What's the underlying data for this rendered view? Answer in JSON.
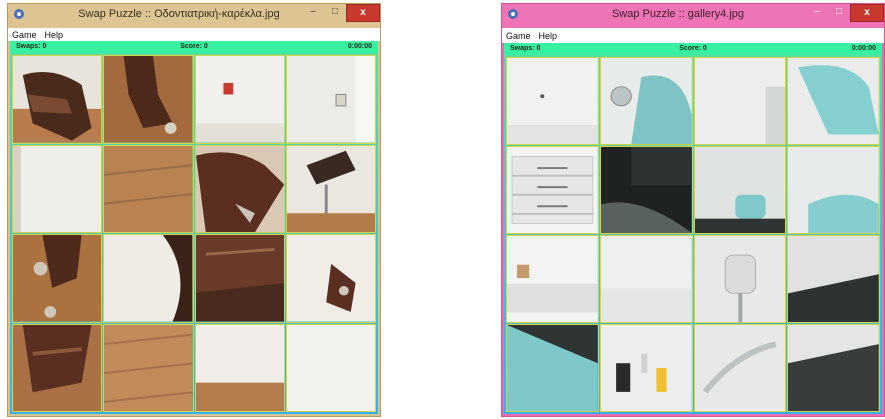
{
  "window1": {
    "title": "Swap Puzzle :: Οδοντιατρική-καρέκλα.jpg",
    "menu": [
      "Game",
      "Help"
    ],
    "status": {
      "swaps": "Swaps: 0",
      "score": "Score: 0",
      "time": "0:00:00"
    },
    "controls": {
      "minimize": "–",
      "maximize": "□",
      "close": "x"
    }
  },
  "window2": {
    "title": "Swap Puzzle :: gallery4.jpg",
    "menu": [
      "Game",
      "Help"
    ],
    "status": {
      "swaps": "Swaps: 0",
      "score": "Score: 0",
      "time": "0:00:00"
    },
    "controls": {
      "minimize": "–",
      "maximize": "□",
      "close": "x"
    }
  },
  "colors": {
    "status_bg": "#38f0a2",
    "tile_border": "#dcd140",
    "win1_titlebar": "#dcc593",
    "win2_titlebar": "#ef74b6",
    "close_button": "#c8382e"
  }
}
